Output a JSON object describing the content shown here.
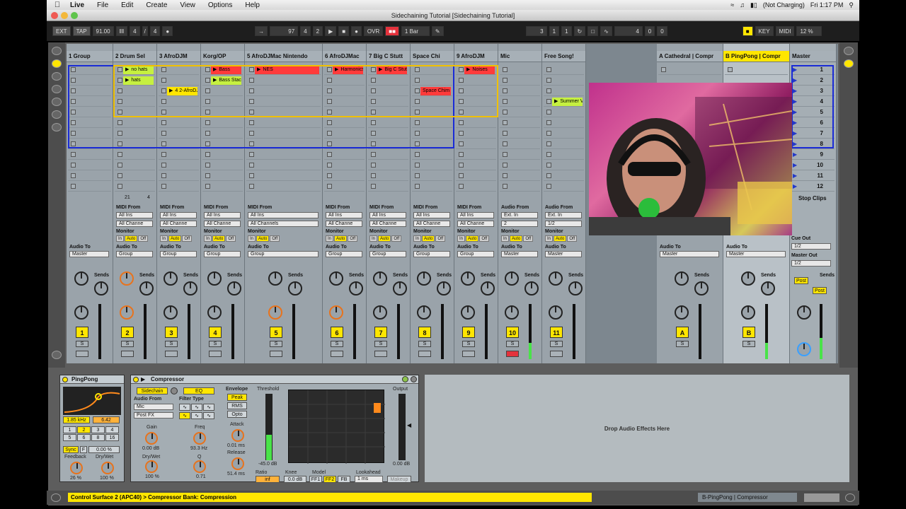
{
  "menubar": {
    "app": "Live",
    "items": [
      "File",
      "Edit",
      "Create",
      "View",
      "Options",
      "Help"
    ],
    "battery": "(Not Charging)",
    "clock": "Fri 1:17 PM"
  },
  "window": {
    "title": "Sidechaining Tutorial  [Sidechaining Tutorial]"
  },
  "transport": {
    "ext": "EXT",
    "tap": "TAP",
    "tempo": "91.00",
    "sig_num": "4",
    "sig_den": "4",
    "pos_bar": "97",
    "pos_beat": "4",
    "pos_sixteenth": "2",
    "ovr": "OVR",
    "quant": "1 Bar",
    "loop_start_bar": "3",
    "loop_start_beat": "1",
    "loop_start_six": "1",
    "loop_len_bar": "4",
    "loop_len_beat": "0",
    "loop_len_six": "0",
    "key": "KEY",
    "midi": "MIDI",
    "cpu": "12 %"
  },
  "tracks": [
    {
      "name": "1 Group",
      "num": "1"
    },
    {
      "name": "2 Drum Sel",
      "num": "2"
    },
    {
      "name": "3 AfroDJM",
      "num": "3"
    },
    {
      "name": "Korg/OP",
      "num": "4"
    },
    {
      "name": "5 AfroDJMac Nintendo",
      "num": "5"
    },
    {
      "name": "6 AfroDJMac",
      "num": "6"
    },
    {
      "name": "7 Big C Stutt",
      "num": "7"
    },
    {
      "name": "Space Chi",
      "num": "8"
    },
    {
      "name": "9 AfroDJM",
      "num": "9"
    },
    {
      "name": "Mic",
      "num": "10"
    },
    {
      "name": "Free Song!",
      "num": "11"
    },
    {
      "name": "A Cathedral | Compr",
      "num": "A"
    },
    {
      "name": "B PingPong | Compr",
      "num": "B"
    },
    {
      "name": "Master",
      "num": ""
    }
  ],
  "clips": {
    "c1": "no hats",
    "c2": "hats",
    "c3": "4 2-AfroDJM",
    "c4": "Bass",
    "c5": "Bass Stacat",
    "c6": "NES",
    "c7": "Harmonics",
    "c8": "Big C Stutte",
    "c9": "Space Chim",
    "c10": "Noises",
    "c11": "Summer Va"
  },
  "scenes": [
    "1",
    "2",
    "3",
    "4",
    "5",
    "6",
    "7",
    "8",
    "9",
    "10",
    "11",
    "12"
  ],
  "stop_clips": "Stop Clips",
  "io": {
    "midi_from": "MIDI From",
    "audio_from": "Audio From",
    "audio_to": "Audio To",
    "monitor": "Monitor",
    "all_ins": "All Ins",
    "all_channels": "All Channe",
    "all_channels_full": "All Channels",
    "ext_in": "Ext. In",
    "input_2": "2",
    "input_12": "1/2",
    "group": "Group",
    "master": "Master",
    "mon_in": "In",
    "mon_auto": "Auto",
    "mon_off": "Off",
    "cue_out": "Cue Out",
    "master_out": "Master Out",
    "cue_val": "1/2",
    "master_val": "1/2",
    "sends": "Sends",
    "post": "Post",
    "solo": "S",
    "stop_count": "21",
    "stop_count2": "4"
  },
  "pingpong": {
    "title": "PingPong",
    "freq": "1.85 kHz",
    "gain": "6.42",
    "sync": "Sync",
    "f": "F",
    "pct": "0.00 %",
    "feedback": "Feedback",
    "drywet": "Dry/Wet",
    "fb_val": "26 %",
    "dw_val": "100 %",
    "beats": [
      "1",
      "2",
      "3",
      "4",
      "5",
      "6",
      "8",
      "16"
    ]
  },
  "compressor": {
    "title": "Compressor",
    "sidechain": "Sidechain",
    "eq": "EQ",
    "audio_from": "Audio From",
    "source": "Mic",
    "post_fx": "Post FX",
    "filter_type": "Filter Type",
    "gain": "Gain",
    "gain_val": "0.00 dB",
    "freq": "Freq",
    "freq_val": "93.3 Hz",
    "drywet": "Dry/Wet",
    "dw_val": "100 %",
    "q": "Q",
    "q_val": "0.71",
    "envelope": "Envelope",
    "peak": "Peak",
    "rms": "RMS",
    "opto": "Opto",
    "attack": "Attack",
    "attack_val": "0.01 ms",
    "release": "Release",
    "release_val": "51.4 ms",
    "threshold": "Threshold",
    "threshold_val": "-45.0 dB",
    "output": "Output",
    "output_val": "0.00 dB",
    "ratio": "Ratio",
    "ratio_val": "inf",
    "knee": "Knee",
    "knee_val": "0.0 dB",
    "model": "Model",
    "ff1": "FF1",
    "ff2": "FF2",
    "fb": "FB",
    "lookahead": "Lookahead",
    "lookahead_val": "1 ms",
    "makeup": "Makeup"
  },
  "drop_text": "Drop Audio Effects Here",
  "status": {
    "message": "Control Surface 2 (APC40) > Compressor Bank: Compression",
    "right": "B-PingPong | Compressor"
  },
  "colors": {
    "accent_yellow": "#ffe600",
    "clip_red": "#ff3b3b",
    "clip_lime": "#c6f040",
    "meter_green": "#49e349",
    "arm_red": "#e4323c"
  }
}
